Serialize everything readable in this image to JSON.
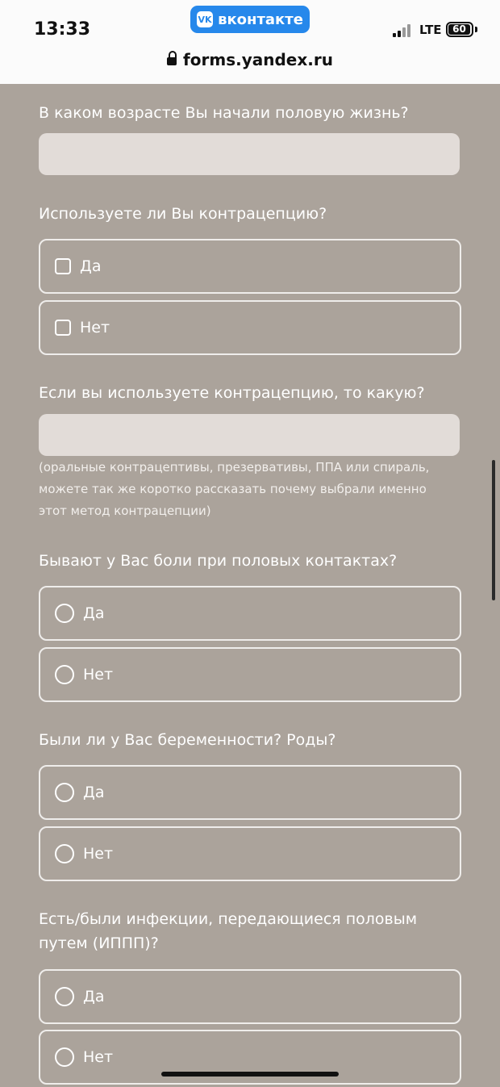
{
  "status_bar": {
    "time": "13:33",
    "app_badge": "вконтакте",
    "app_logo": "VK",
    "network": "LTE",
    "battery": "60",
    "url": "forms.yandex.ru"
  },
  "form": {
    "q1": {
      "label": "В каком возрасте Вы начали половую жизнь?"
    },
    "q2": {
      "label": "Используете ли Вы контрацепцию?",
      "options": [
        "Да",
        "Нет"
      ]
    },
    "q3": {
      "label": "Если вы используете контрацепцию, то какую?",
      "hint": "(оральные контрацептивы, презервативы, ППА или спираль, можете так же коротко рассказать почему выбрали именно этот метод контрацепции)"
    },
    "q4": {
      "label": "Бывают у Вас боли при половых контактах?",
      "options": [
        "Да",
        "Нет"
      ]
    },
    "q5": {
      "label": "Были ли у Вас беременности? Роды?",
      "options": [
        "Да",
        "Нет"
      ]
    },
    "q6": {
      "label": "Есть/были инфекции, передающиеся половым путем (ИППП)?",
      "options": [
        "Да",
        "Нет"
      ]
    }
  }
}
